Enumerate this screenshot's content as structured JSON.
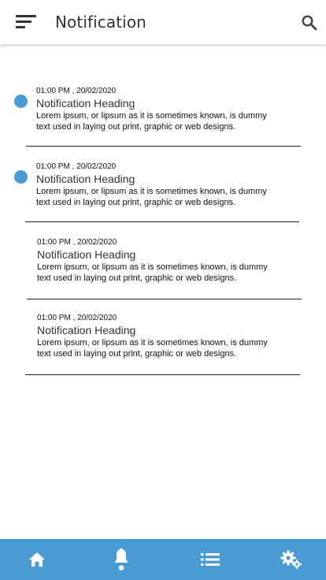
{
  "header": {
    "title": "Notification",
    "menu_icon": "sort-menu-icon",
    "search_icon": "search-icon"
  },
  "notifications": [
    {
      "time": "01:00 PM , 20/02/2020",
      "heading": "Notification Heading",
      "body_line1": "Lorem ipsum, or lipsum as it is sometimes known, is dummy",
      "body_line2": "text used in laying out print, graphic or web designs.",
      "unread": true
    },
    {
      "time": "01:00 PM , 20/02/2020",
      "heading": "Notification Heading",
      "body_line1": "Lorem ipsum, or lipsum as it is sometimes known, is dummy",
      "body_line2": "text used in laying out print, graphic or web designs.",
      "unread": true
    },
    {
      "time": "01:00 PM , 20/02/2020",
      "heading": "Notification Heading",
      "body_line1": "Lorem ipsum, or lipsum as it is sometimes known, is dummy",
      "body_line2": "text used in laying out print, graphic or web designs.",
      "unread": false
    },
    {
      "time": "01:00 PM , 20/02/2020",
      "heading": "Notification Heading",
      "body_line1": "Lorem ipsum, or lipsum as it is sometimes known, is dummy",
      "body_line2": "text used in laying out print, graphic or web designs.",
      "unread": false
    }
  ],
  "bottom_nav": {
    "items": [
      "home-icon",
      "bell-icon",
      "list-icon",
      "settings-gears-icon"
    ],
    "active": "bell-icon"
  },
  "colors": {
    "accent": "#4a9bd4",
    "unread_dot": "#4a9bd4",
    "nav_icon": "#ffffff",
    "divider": "#222222"
  }
}
